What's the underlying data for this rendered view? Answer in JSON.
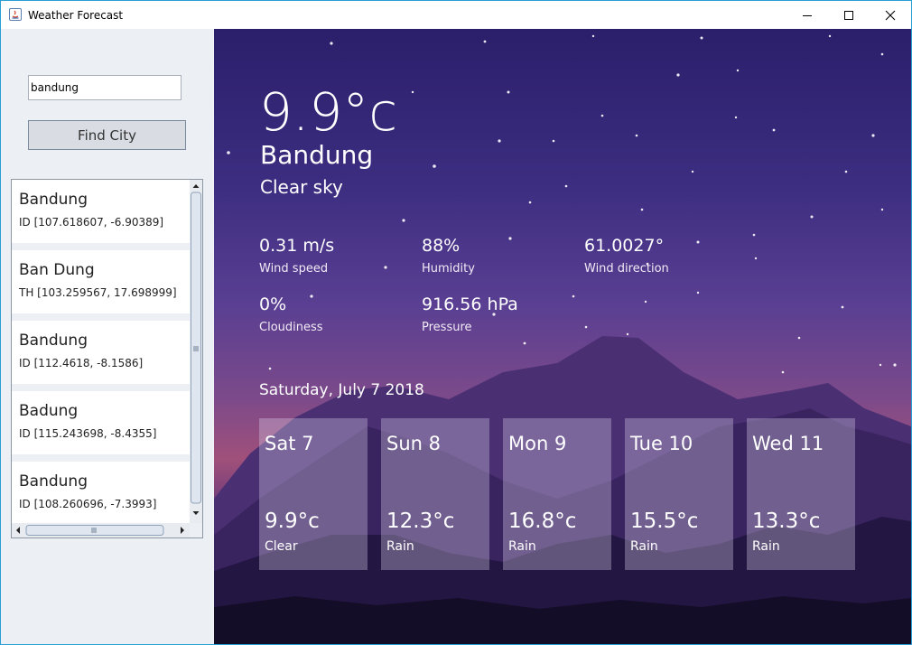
{
  "window": {
    "title": "Weather Forecast"
  },
  "search": {
    "value": "bandung",
    "button_label": "Find City"
  },
  "cities": [
    {
      "name": "Bandung",
      "coords": "ID [107.618607, -6.90389]"
    },
    {
      "name": "Ban Dung",
      "coords": "TH [103.259567, 17.698999]"
    },
    {
      "name": "Bandung",
      "coords": "ID [112.4618, -8.1586]"
    },
    {
      "name": "Badung",
      "coords": "ID [115.243698, -8.4355]"
    },
    {
      "name": "Bandung",
      "coords": "ID [108.260696, -7.3993]"
    }
  ],
  "current": {
    "temperature": "9.9°c",
    "city": "Bandung",
    "condition": "Clear sky",
    "wind_speed": {
      "value": "0.31 m/s",
      "label": "Wind speed"
    },
    "humidity": {
      "value": "88%",
      "label": "Humidity"
    },
    "wind_direction": {
      "value": "61.0027°",
      "label": "Wind direction"
    },
    "cloudiness": {
      "value": "0%",
      "label": "Cloudiness"
    },
    "pressure": {
      "value": "916.56 hPa",
      "label": "Pressure"
    },
    "date": "Saturday, July 7 2018"
  },
  "forecast": [
    {
      "day": "Sat 7",
      "temp": "9.9°c",
      "condition": "Clear"
    },
    {
      "day": "Sun 8",
      "temp": "12.3°c",
      "condition": "Rain"
    },
    {
      "day": "Mon 9",
      "temp": "16.8°c",
      "condition": "Rain"
    },
    {
      "day": "Tue 10",
      "temp": "15.5°c",
      "condition": "Rain"
    },
    {
      "day": "Wed 11",
      "temp": "13.3°c",
      "condition": "Rain"
    }
  ],
  "colors": {
    "window_border": "#2a9fd6",
    "sky_top": "#2b1f6b",
    "sky_glow": "#a0507a",
    "mountain": "#2a1d4a"
  }
}
